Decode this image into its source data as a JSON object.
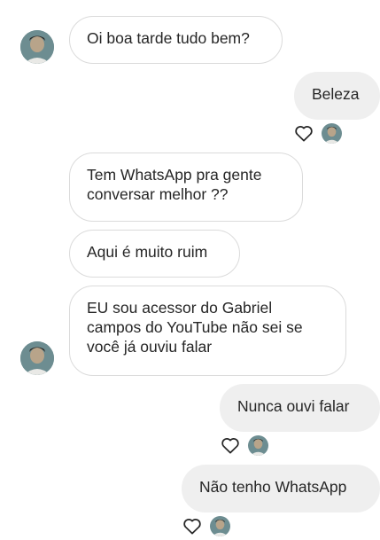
{
  "conversation": {
    "messages": [
      {
        "from": "them",
        "text": "Oi boa tarde tudo bem?"
      },
      {
        "from": "me",
        "text": "Beleza"
      },
      {
        "from": "them",
        "text": "Tem WhatsApp pra gente\nconversar melhor ??"
      },
      {
        "from": "them",
        "text": "Aqui é muito ruim"
      },
      {
        "from": "them",
        "text": "EU sou acessor do Gabriel\ncampos do YouTube não sei se\nvocê já ouviu falar"
      },
      {
        "from": "me",
        "text": "Nunca ouvi falar"
      },
      {
        "from": "me",
        "text": "Não tenho WhatsApp"
      }
    ]
  },
  "icons": {
    "avatar": "profile-photo",
    "seen": "seen-avatar",
    "like": "heart-outline-icon"
  },
  "colors": {
    "incoming_bubble": "#ffffff",
    "incoming_border": "#dbdbdb",
    "outgoing_bubble": "#efefef",
    "text": "#262626"
  }
}
